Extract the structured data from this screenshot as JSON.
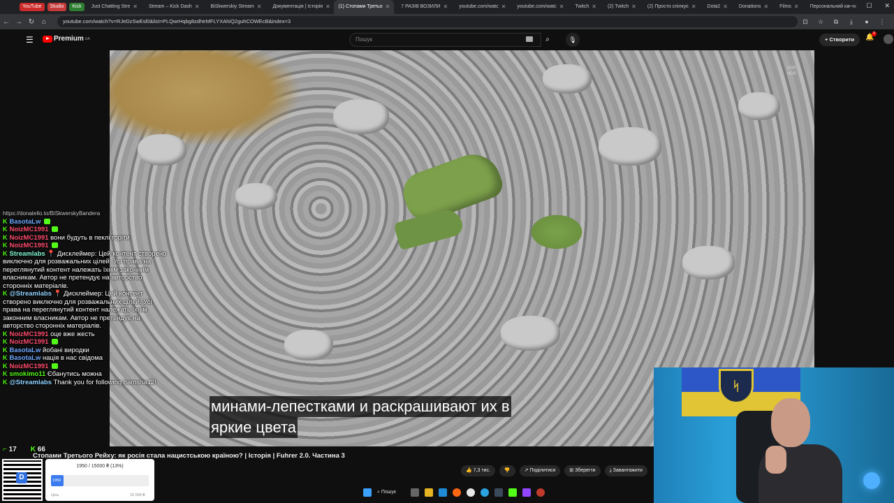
{
  "browser": {
    "tab_chips": [
      {
        "label": "YouTube",
        "color": "#cc2b2b"
      },
      {
        "label": "Studio",
        "color": "#c43a3a"
      },
      {
        "label": "Kick",
        "color": "#2e7d32"
      }
    ],
    "tabs": [
      {
        "label": "Just Chatting Stre",
        "active": false
      },
      {
        "label": "Stream – Kick Dash",
        "active": false
      },
      {
        "label": "BiSkwerskiy Stream",
        "active": false
      },
      {
        "label": "Документація | Історія",
        "active": false
      },
      {
        "label": "(1) Стопами Третьо",
        "active": true
      },
      {
        "label": "7 РАЗІВ ВОЗИЛИ",
        "active": false
      },
      {
        "label": "youtube.com/watc",
        "active": false
      },
      {
        "label": "youtube.com/watc",
        "active": false
      },
      {
        "label": "Twitch",
        "active": false
      },
      {
        "label": "(2) Twitch",
        "active": false
      },
      {
        "label": "(2) Просто спілкує",
        "active": false
      },
      {
        "label": "Dota2",
        "active": false
      },
      {
        "label": "Donations",
        "active": false
      },
      {
        "label": "Films",
        "active": false
      },
      {
        "label": "Персональний ка",
        "active": false
      }
    ],
    "url": "youtube.com/watch?v=RJeDzSwEsl0&list=PLQwrHqbg8zdhtrMFLYXAhiQ2guhCOWEcB&index=3"
  },
  "youtube_header": {
    "logo_text": "Premium",
    "logo_region": "UA",
    "search_placeholder": "Пошук",
    "create_label": "Створити",
    "notification_count": "9"
  },
  "video": {
    "quality_badge": "VSR\nHDR",
    "subtitle_line1": "минами-лепестками и раскрашивают их в",
    "subtitle_line2": "яркие цвета",
    "title": "Стопами Третього Рейху: як росія стала нацистською країною? | Історія | Fuhrer 2.0. Частина 3",
    "likes": "7,3 тис.",
    "share_label": "Поділитися",
    "save_label": "Зберегти",
    "download_label": "Завантажити"
  },
  "chat": {
    "top_cut": "https://donatello.to/BiSkwerskyBandera",
    "messages": [
      {
        "user": "BasotaLw",
        "color": "#6fa8ff",
        "text": "",
        "emote": true
      },
      {
        "user": "NoizMC1991",
        "color": "#ff4d6d",
        "text": "",
        "emote": true
      },
      {
        "user": "NoizMC1991",
        "color": "#ff4d6d",
        "text": "вони будуть в пеклі горіти",
        "emote": false
      },
      {
        "user": "NoizMC1991",
        "color": "#ff4d6d",
        "text": "",
        "emote": true
      },
      {
        "user": "Streamlabs",
        "color": "#80f5d2",
        "text": "📍 Дисклеймер: Цей контент створено виключно для розважальних цілей. Усі права на переглянутий контент належать їхнім законним власникам. Автор не претендує на авторство сторонніх матеріалів.",
        "emote": false
      },
      {
        "user": "@Streamlabs",
        "color": "#8fd3ff",
        "text": "📍 Дисклеймер: Цей контент створено виключно для розважальних цілей. Усі права на переглянутий контент належать їхнім законним власникам. Автор не претендує на авторство сторонніх матеріалів.",
        "emote": false
      },
      {
        "user": "NoizMC1991",
        "color": "#ff4d6d",
        "text": "оце вже жесть",
        "emote": false
      },
      {
        "user": "NoizMC1991",
        "color": "#ff4d6d",
        "text": "",
        "emote": true
      },
      {
        "user": "BasotaLw",
        "color": "#6fa8ff",
        "text": "йобані виродки",
        "emote": false
      },
      {
        "user": "BasotaLw",
        "color": "#6fa8ff",
        "text": "нація в нас свідома",
        "emote": false
      },
      {
        "user": "NoizMC1991",
        "color": "#ff4d6d",
        "text": "",
        "emote": true
      },
      {
        "user": "smokimo11",
        "color": "#53fc18",
        "text": "Єбанутись можна",
        "emote": false
      },
      {
        "user": "@Streamlabs",
        "color": "#8fd3ff",
        "text": "Thank you for following hamsha12!",
        "emote": false
      }
    ],
    "viewers": "17",
    "followers": "66"
  },
  "donation": {
    "progress_text": "1950 / 15000 ₴ (13%)",
    "progress_fraction": 0.13,
    "fill_label": "1950",
    "min_label": "Ціль",
    "max_label": "15 000 ₴"
  },
  "taskbar": {
    "search_label": "Пошук"
  }
}
